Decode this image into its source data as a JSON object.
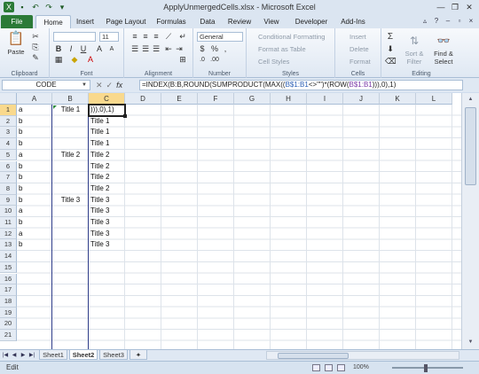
{
  "window": {
    "title": "ApplyUnmergedCells.xlsx - Microsoft Excel"
  },
  "tabs": [
    "File",
    "Home",
    "Insert",
    "Page Layout",
    "Formulas",
    "Data",
    "Review",
    "View",
    "Developer",
    "Add-Ins"
  ],
  "ribbon": {
    "clipboard": {
      "paste": "Paste",
      "label": "Clipboard"
    },
    "font": {
      "size": "11",
      "bold": "B",
      "italic": "I",
      "underline": "U",
      "label": "Font"
    },
    "alignment": {
      "label": "Alignment"
    },
    "number": {
      "format": "General",
      "currency": "$",
      "percent": "%",
      "comma": ",",
      "label": "Number"
    },
    "styles": {
      "conditional": "Conditional Formatting",
      "table": "Format as Table",
      "cell": "Cell Styles",
      "label": "Styles"
    },
    "cells": {
      "insert": "Insert",
      "delete": "Delete",
      "format": "Format",
      "label": "Cells"
    },
    "editing": {
      "sigma": "Σ",
      "sort": "Sort &",
      "filter": "Filter",
      "find": "Find &",
      "select": "Select",
      "label": "Editing"
    }
  },
  "formula_bar": {
    "name_box": "CODE",
    "fx": "fx",
    "cancel": "✕",
    "enter": "✓",
    "f1": "=INDEX(B:B,ROUND(SUMPRODUCT(MAX((",
    "f2": "B$1:B1",
    "f3": "<>\"\")*(ROW(",
    "f4": "B$1:B1",
    "f5": "))),0),1)"
  },
  "grid": {
    "columns": [
      "A",
      "B",
      "C",
      "D",
      "E",
      "F",
      "G",
      "H",
      "I",
      "J",
      "K",
      "L"
    ],
    "rows": [
      "1",
      "2",
      "3",
      "4",
      "5",
      "6",
      "7",
      "8",
      "9",
      "10",
      "11",
      "12",
      "13",
      "14",
      "15",
      "16",
      "17",
      "18",
      "19",
      "20",
      "21"
    ],
    "col_a": [
      "a",
      "b",
      "b",
      "b",
      "a",
      "b",
      "b",
      "b",
      "b",
      "a",
      "b",
      "a",
      "b"
    ],
    "col_b": {
      "row1": "Title 1",
      "row5": "Title 2",
      "row9": "Title 3"
    },
    "col_c": [
      "))),0),1)",
      "Title 1",
      "Title 1",
      "Title 1",
      "Title 2",
      "Title 2",
      "Title 2",
      "Title 2",
      "Title 3",
      "Title 3",
      "Title 3",
      "Title 3",
      "Title 3"
    ]
  },
  "sheets": [
    "Sheet1",
    "Sheet2",
    "Sheet3"
  ],
  "status": {
    "mode": "Edit",
    "zoom": "100%"
  }
}
